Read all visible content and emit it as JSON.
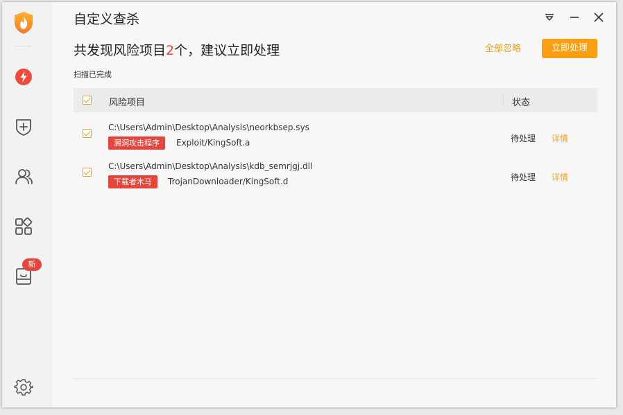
{
  "window": {
    "title": "自定义查杀"
  },
  "sidebar": {
    "items": [
      {
        "name": "flash-scan",
        "icon": "lightning-icon"
      },
      {
        "name": "protection",
        "icon": "shield-plus-icon"
      },
      {
        "name": "users",
        "icon": "users-icon"
      },
      {
        "name": "apps",
        "icon": "apps-grid-icon"
      },
      {
        "name": "toolbox",
        "icon": "box-icon",
        "badge": "新"
      }
    ],
    "settings_icon": "gear-icon"
  },
  "header": {
    "headline_prefix": "共发现风险项目",
    "headline_count": "2",
    "headline_suffix": "个，建议立即处理",
    "ignore_all_label": "全部忽略",
    "handle_now_label": "立即处理",
    "scan_status": "扫描已完成"
  },
  "table": {
    "columns": {
      "name": "风险项目",
      "status": "状态"
    },
    "rows": [
      {
        "path": "C:\\Users\\Admin\\Desktop\\Analysis\\neorkbsep.sys",
        "tag": "漏洞攻击程序",
        "threat": "Exploit/KingSoft.a",
        "status": "待处理",
        "details": "详情"
      },
      {
        "path": "C:\\Users\\Admin\\Desktop\\Analysis\\kdb_semrjgj.dll",
        "tag": "下载者木马",
        "threat": "TrojanDownloader/KingSoft.d",
        "status": "待处理",
        "details": "详情"
      }
    ]
  },
  "colors": {
    "accent": "#fa9e12",
    "danger": "#e5453a",
    "link": "#f0a020"
  }
}
